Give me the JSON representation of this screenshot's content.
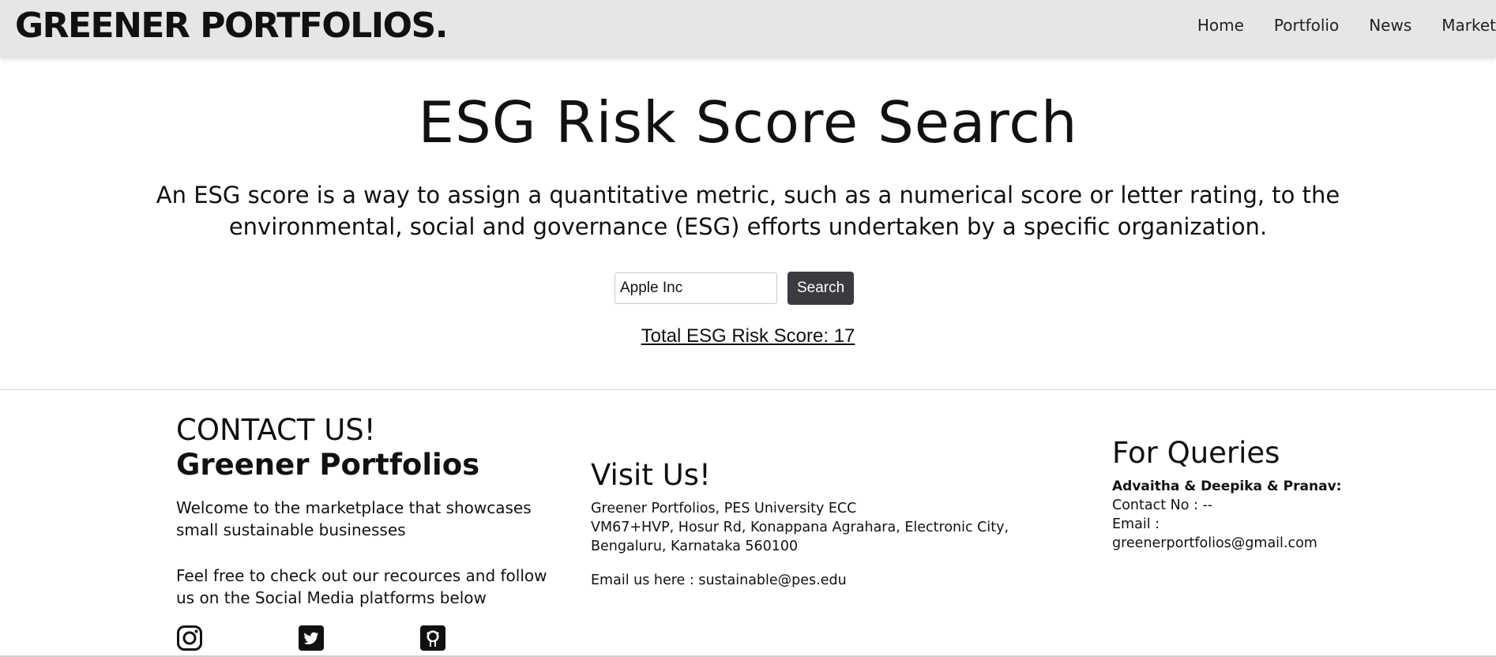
{
  "header": {
    "brand": "GREENER PORTFOLIOS.",
    "nav": [
      "Home",
      "Portfolio",
      "News",
      "Market"
    ]
  },
  "hero": {
    "title": "ESG Risk Score Search",
    "description": "An ESG score is a way to assign a quantitative metric, such as a numerical score or letter rating, to the environmental, social and governance (ESG) efforts undertaken by a specific organization."
  },
  "search": {
    "value": "Apple Inc",
    "button_label": "Search",
    "result": "Total ESG Risk Score: 17"
  },
  "footer": {
    "contact": {
      "heading": "CONTACT US!",
      "brand": "Greener Portfolios",
      "welcome": "Welcome to the marketplace that showcases small sustainable businesses",
      "follow": "Feel free to check out our recources and follow us on the Social Media platforms below",
      "socials": [
        "instagram-icon",
        "twitter-icon",
        "github-icon"
      ]
    },
    "visit": {
      "heading": "Visit Us!",
      "address_line1": "Greener Portfolios, PES University ECC",
      "address_line2": "VM67+HVP, Hosur Rd, Konappana Agrahara, Electronic City, Bengaluru, Karnataka 560100",
      "email": "Email us here : sustainable@pes.edu"
    },
    "queries": {
      "heading": "For Queries",
      "names": "Advaitha & Deepika & Pranav:",
      "contact_no": "Contact No : --",
      "email_label": "Email :",
      "email": "greenerportfolios@gmail.com"
    }
  }
}
